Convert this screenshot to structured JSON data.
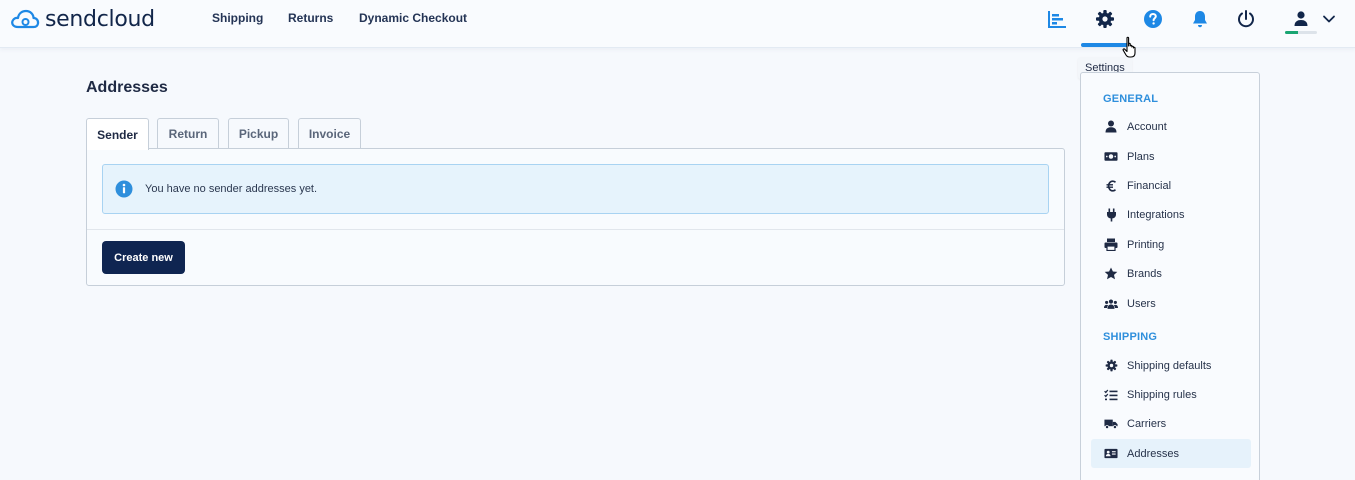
{
  "brand": {
    "name": "sendcloud",
    "color": "#1e88e5"
  },
  "nav": {
    "items": [
      {
        "label": "Shipping"
      },
      {
        "label": "Returns"
      },
      {
        "label": "Dynamic Checkout"
      }
    ]
  },
  "toolbar": {
    "icons": [
      "analytics-icon",
      "settings-icon",
      "help-icon",
      "notifications-icon",
      "power-icon",
      "user-icon",
      "chevron-down-icon"
    ],
    "active": "settings-icon",
    "user_progress_fraction": 0.4
  },
  "tooltip": {
    "text": "Settings"
  },
  "page": {
    "title": "Addresses",
    "tabs": [
      {
        "label": "Sender",
        "active": true
      },
      {
        "label": "Return",
        "active": false
      },
      {
        "label": "Pickup",
        "active": false
      },
      {
        "label": "Invoice",
        "active": false
      }
    ],
    "info_message": "You have no sender addresses yet.",
    "create_button": "Create new"
  },
  "settings_menu": {
    "sections": [
      {
        "heading": "GENERAL",
        "items": [
          {
            "label": "Account",
            "icon": "user-icon"
          },
          {
            "label": "Plans",
            "icon": "money-icon"
          },
          {
            "label": "Financial",
            "icon": "euro-icon"
          },
          {
            "label": "Integrations",
            "icon": "plug-icon"
          },
          {
            "label": "Printing",
            "icon": "printer-icon"
          },
          {
            "label": "Brands",
            "icon": "star-icon"
          },
          {
            "label": "Users",
            "icon": "users-icon"
          }
        ]
      },
      {
        "heading": "SHIPPING",
        "items": [
          {
            "label": "Shipping defaults",
            "icon": "gear-icon"
          },
          {
            "label": "Shipping rules",
            "icon": "checklist-icon"
          },
          {
            "label": "Carriers",
            "icon": "truck-icon"
          },
          {
            "label": "Addresses",
            "icon": "address-card-icon",
            "selected": true
          }
        ]
      }
    ]
  },
  "colors": {
    "accent": "#1e88e5",
    "primary_button": "#0f2551",
    "info_bg": "#e6f3fc",
    "info_border": "#a8d3f2",
    "progress": "#1aa572"
  }
}
